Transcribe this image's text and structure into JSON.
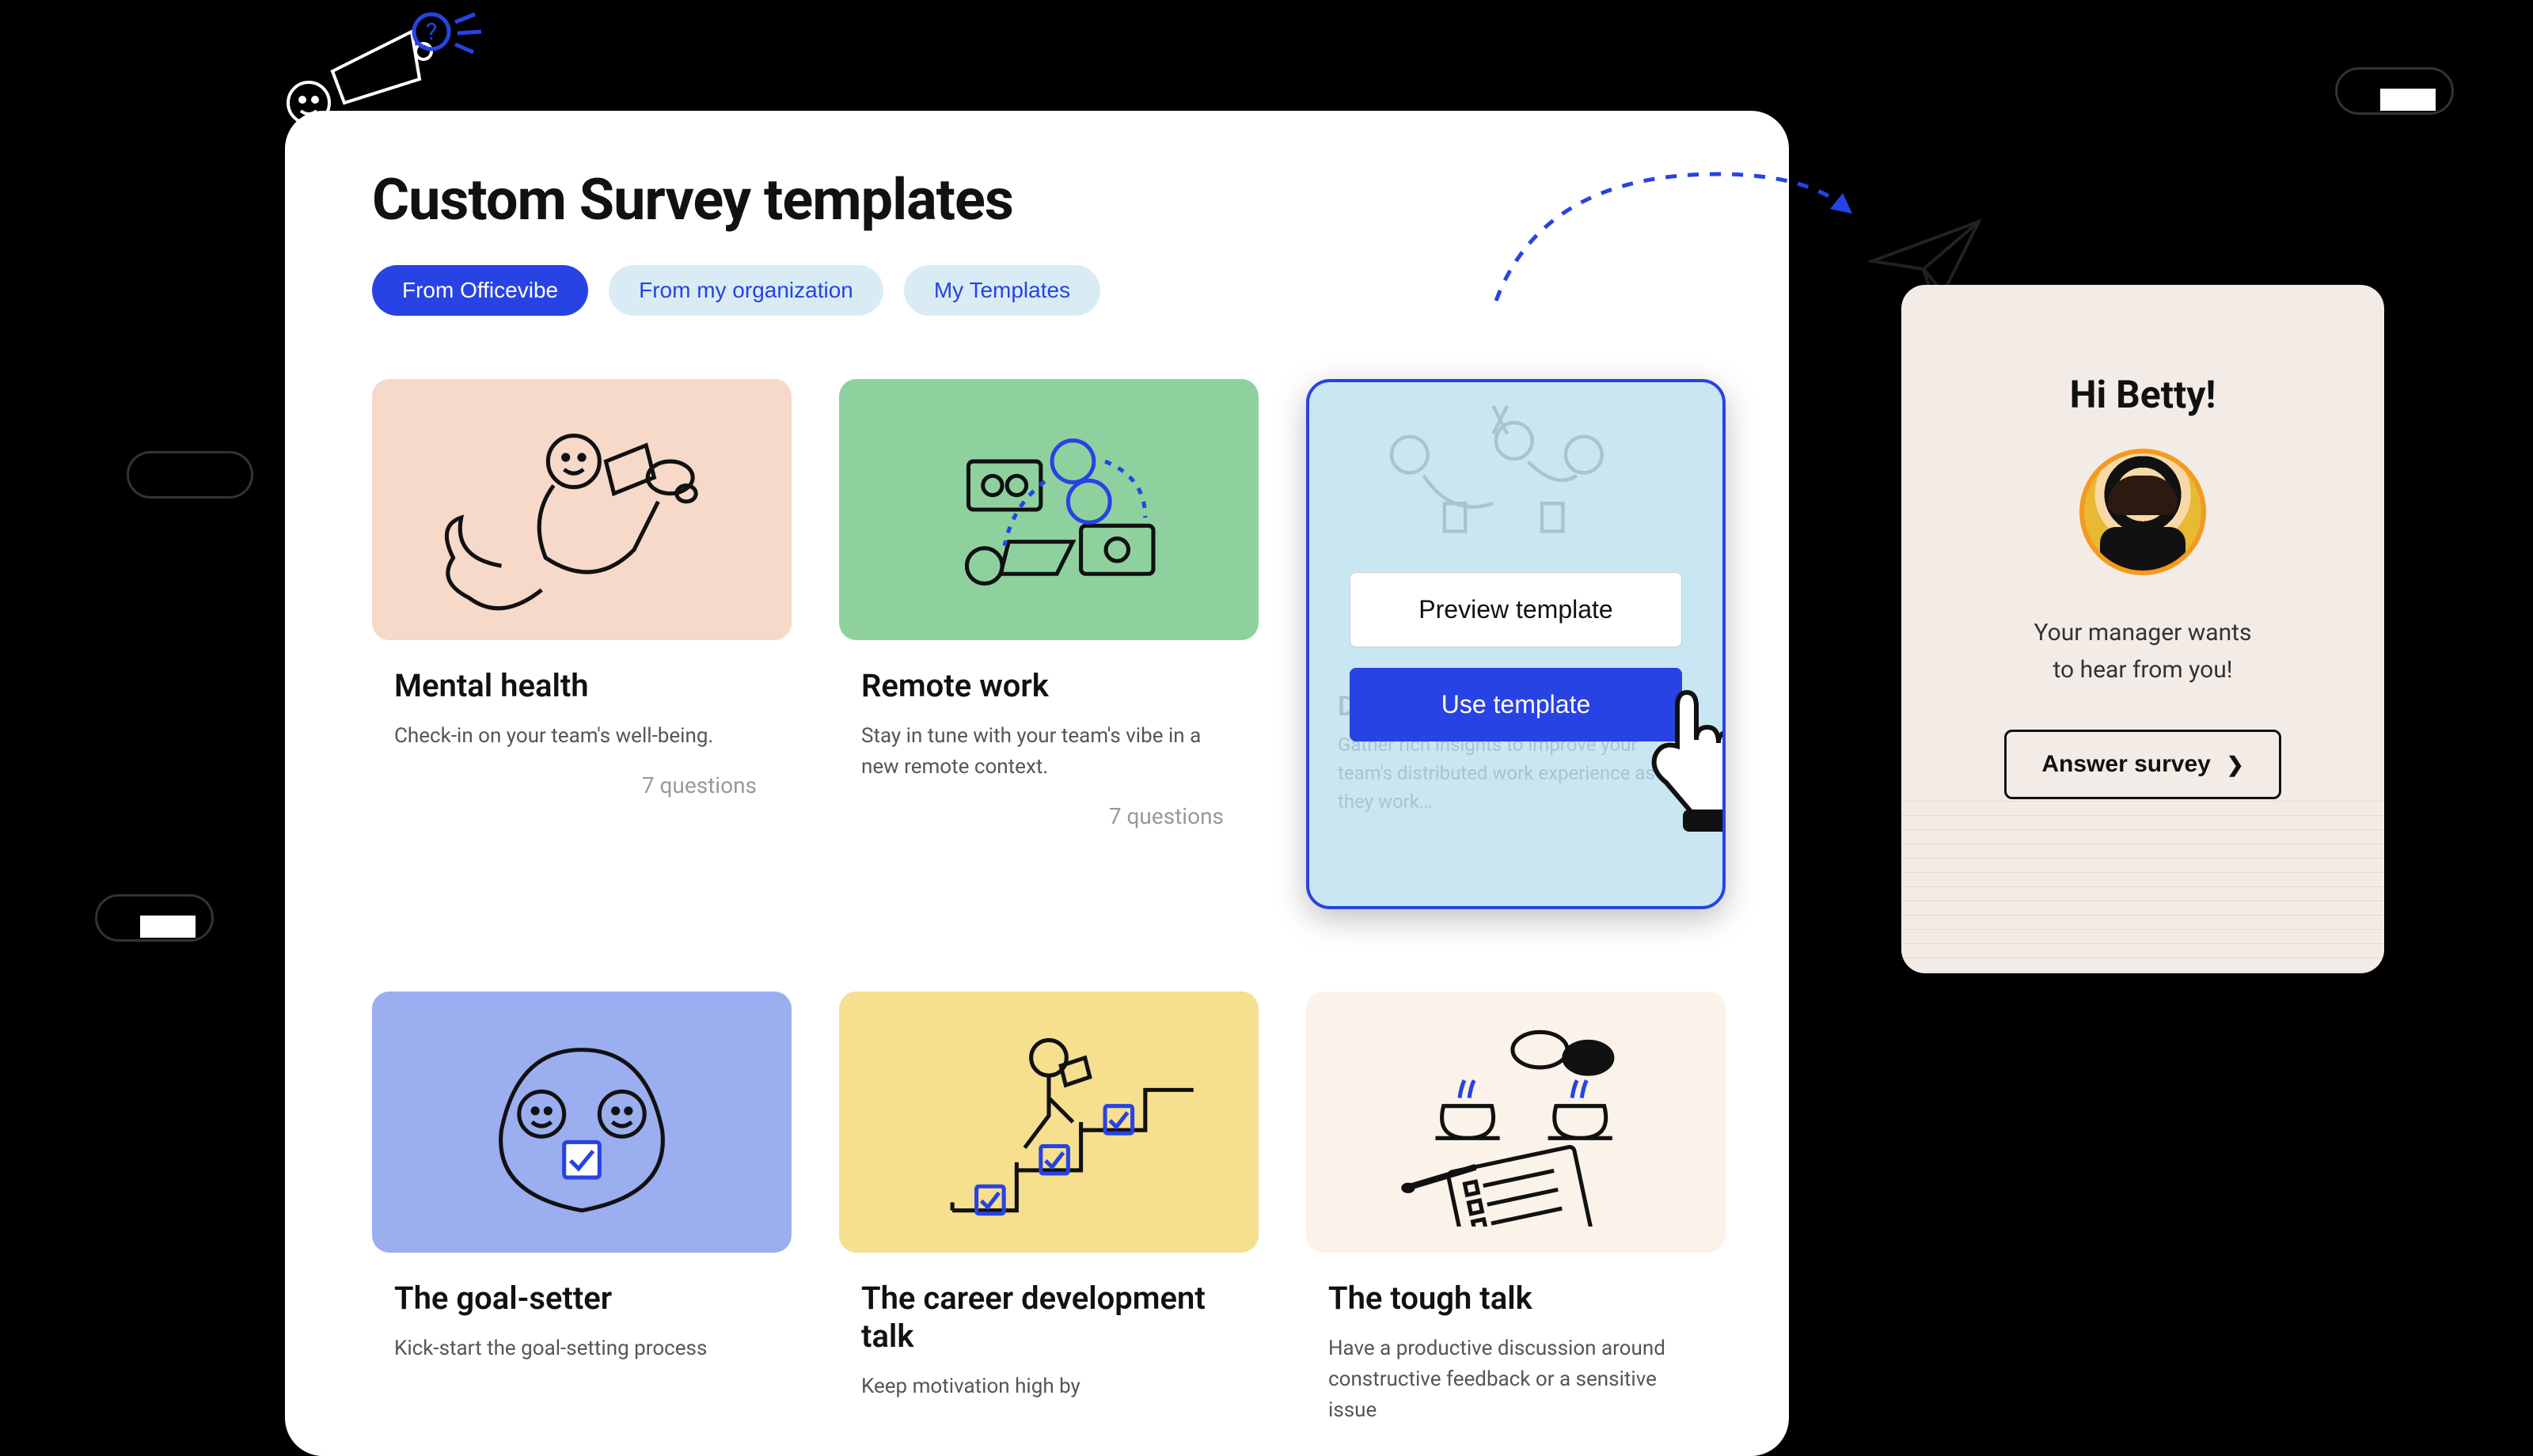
{
  "page_title": "Custom Survey templates",
  "filters": [
    {
      "label": "From Officevibe",
      "active": true
    },
    {
      "label": "From my organization",
      "active": false
    },
    {
      "label": "My Templates",
      "active": false
    }
  ],
  "templates": [
    {
      "title": "Mental health",
      "description": "Check-in on your team's well-being.",
      "questions": "7 questions",
      "bg": "#f6d9c9"
    },
    {
      "title": "Remote work",
      "description": "Stay in tune with your team's vibe in a new remote context.",
      "questions": "7 questions",
      "bg": "#8ed19f"
    },
    {
      "title": "D",
      "ghost_description": "Gather rich insights to improve your team's distributed work experience as they work…",
      "preview_label": "Preview template",
      "use_label": "Use template",
      "bg": "#c9e6f3"
    },
    {
      "title": "The goal-setter",
      "description": "Kick-start the goal-setting process",
      "bg": "#9aaef0"
    },
    {
      "title": "The career development talk",
      "description": "Keep motivation high by",
      "bg": "#f6df8e"
    },
    {
      "title": "The tough talk",
      "description": "Have a productive discussion around constructive feedback or a sensitive issue",
      "bg": "#fbf2e9"
    }
  ],
  "survey_widget": {
    "greeting": "Hi Betty!",
    "message_line1": "Your manager wants",
    "message_line2": "to hear from you!",
    "cta": "Answer survey"
  },
  "colors": {
    "primary": "#2743e3",
    "pill_inactive_bg": "#d9ecf5"
  }
}
